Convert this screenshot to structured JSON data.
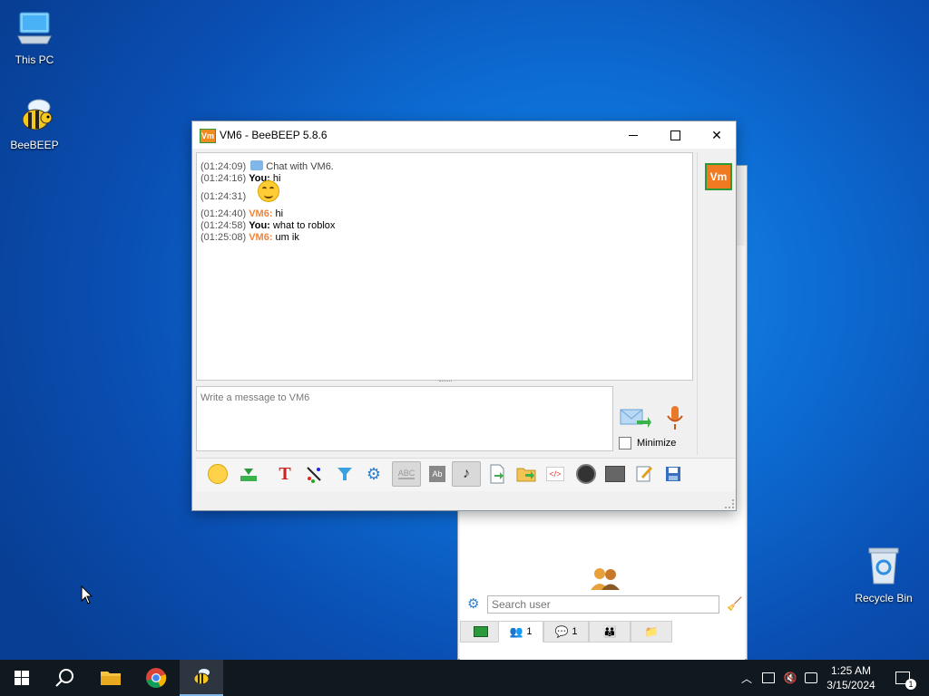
{
  "desktop": {
    "icons": [
      {
        "label": "This PC"
      },
      {
        "label": "BeeBEEP"
      },
      {
        "label": "Recycle Bin"
      }
    ]
  },
  "chat_window": {
    "title": "VM6 - BeeBEEP 5.8.6",
    "app_icon_text": "Vm",
    "messages": [
      {
        "time": "(01:24:09)",
        "sender": "",
        "text": "Chat with VM6.",
        "kind": "system"
      },
      {
        "time": "(01:24:16)",
        "sender": "You:",
        "text": " hi",
        "kind": "you"
      },
      {
        "time": "(01:24:31)",
        "sender": "",
        "text": "",
        "kind": "emoji"
      },
      {
        "time": "(01:24:40)",
        "sender": "VM6:",
        "text": " hi",
        "kind": "vm"
      },
      {
        "time": "(01:24:58)",
        "sender": "You:",
        "text": " what to roblox",
        "kind": "you"
      },
      {
        "time": "(01:25:08)",
        "sender": "VM6:",
        "text": " um ik",
        "kind": "vm"
      }
    ],
    "input_placeholder": "Write a message to VM6",
    "minimize_label": "Minimize",
    "avatar_text": "Vm"
  },
  "main_window": {
    "search_placeholder": "Search user",
    "tabs": [
      {
        "name": "tab-home",
        "count": ""
      },
      {
        "name": "tab-users",
        "count": "1"
      },
      {
        "name": "tab-chats",
        "count": "1"
      },
      {
        "name": "tab-groups",
        "count": ""
      },
      {
        "name": "tab-shares",
        "count": ""
      }
    ]
  },
  "taskbar": {
    "time": "1:25 AM",
    "date": "3/15/2024",
    "notification_count": "1"
  },
  "colors": {
    "accent_orange": "#f0853a",
    "avatar_green_border": "#2d9a3a"
  }
}
